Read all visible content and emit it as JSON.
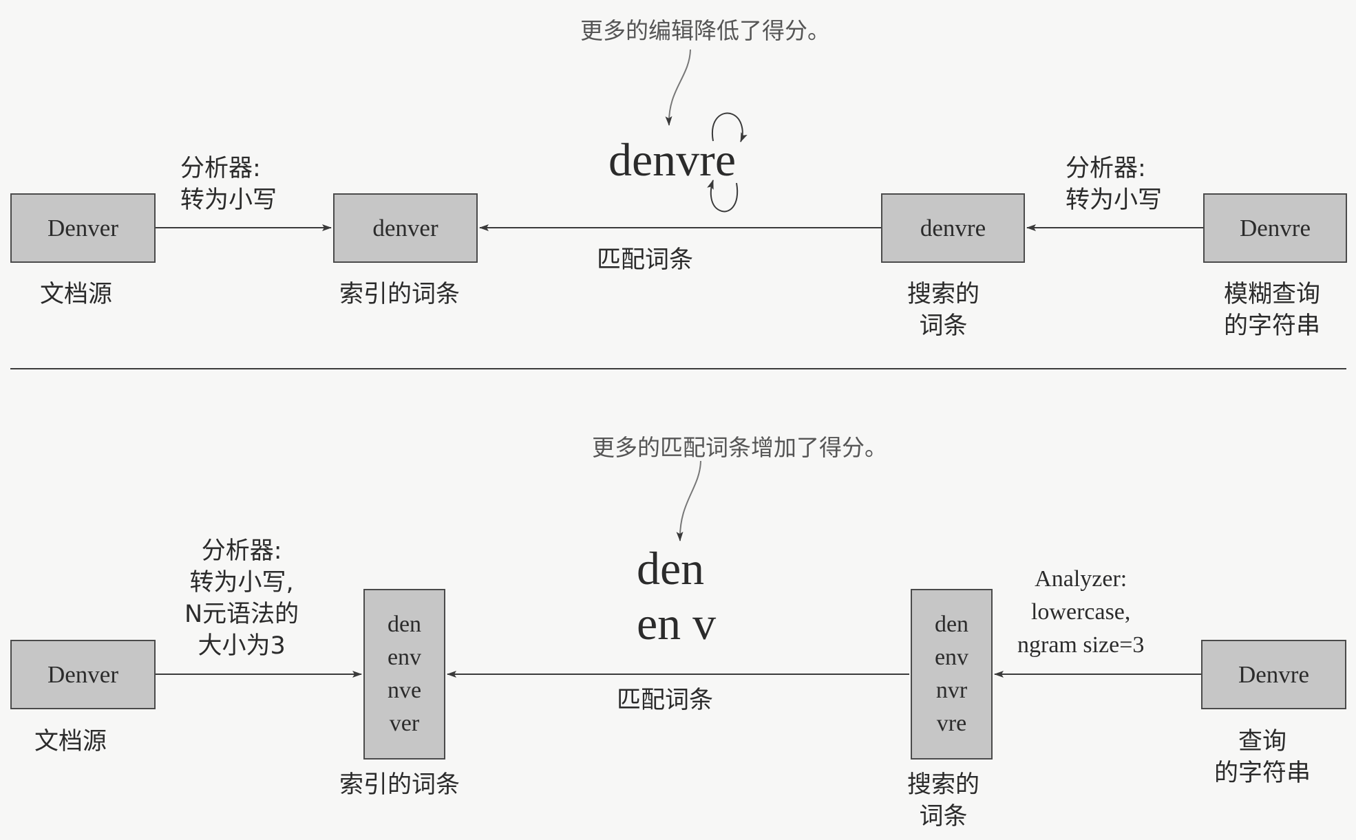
{
  "colors": {
    "box_fill": "#c6c6c6",
    "line": "#3a3a3a",
    "note_text": "#555555"
  },
  "top": {
    "note": "更多的编辑降低了得分。",
    "term": "denvre",
    "match_label": "匹配词条",
    "left_analyzer": [
      "分析器:",
      "转为小写"
    ],
    "right_analyzer": [
      "分析器:",
      "转为小写"
    ],
    "boxes": {
      "source": "Denver",
      "indexed": "denver",
      "search": "denvre",
      "query": "Denvre"
    },
    "captions": {
      "source": [
        "文档源"
      ],
      "indexed": [
        "索引的词条"
      ],
      "search": [
        "搜索的",
        "词条"
      ],
      "query": [
        "模糊查询",
        "的字符串"
      ]
    }
  },
  "bottom": {
    "note": "更多的匹配词条增加了得分。",
    "term_lines": [
      "den",
      "en v"
    ],
    "match_label": "匹配词条",
    "left_analyzer": [
      "分析器:",
      "转为小写,",
      "N元语法的",
      "大小为3"
    ],
    "right_analyzer": [
      "Analyzer:",
      "lowercase,",
      "ngram size=3"
    ],
    "boxes": {
      "source": "Denver",
      "indexed": [
        "den",
        "env",
        "nve",
        "ver"
      ],
      "search": [
        "den",
        "env",
        "nvr",
        "vre"
      ],
      "query": "Denvre"
    },
    "captions": {
      "source": [
        "文档源"
      ],
      "indexed": [
        "索引的词条"
      ],
      "search": [
        "搜索的",
        "词条"
      ],
      "query": [
        "查询",
        "的字符串"
      ]
    }
  }
}
